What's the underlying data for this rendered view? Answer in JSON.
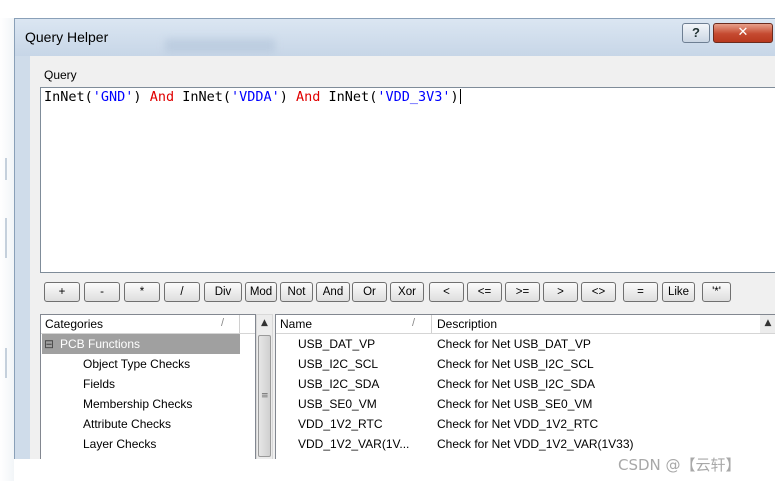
{
  "window": {
    "title": "Query Helper",
    "help_label": "?",
    "close_label": "✕"
  },
  "query": {
    "label": "Query",
    "tokens": [
      {
        "text": "InNet(",
        "kind": "fn"
      },
      {
        "text": "'GND'",
        "kind": "str"
      },
      {
        "text": ") ",
        "kind": "fn"
      },
      {
        "text": "And",
        "kind": "kw"
      },
      {
        "text": " InNet(",
        "kind": "fn"
      },
      {
        "text": "'VDDA'",
        "kind": "str"
      },
      {
        "text": ") ",
        "kind": "fn"
      },
      {
        "text": "And",
        "kind": "kw"
      },
      {
        "text": " InNet(",
        "kind": "fn"
      },
      {
        "text": "'VDD_3V3'",
        "kind": "str"
      },
      {
        "text": ")",
        "kind": "fn"
      }
    ]
  },
  "operators": [
    "+",
    "-",
    "*",
    "/",
    "Div",
    "Mod",
    "Not",
    "And",
    "Or",
    "Xor",
    "<",
    "<=",
    ">=",
    ">",
    "<>",
    "=",
    "Like",
    "'*'"
  ],
  "categories": {
    "header": "Categories",
    "sort_mark": "/",
    "root": {
      "expander": "⊟",
      "label": "PCB Functions"
    },
    "items": [
      "Object Type Checks",
      "Fields",
      "Membership Checks",
      "Attribute Checks",
      "Layer Checks"
    ]
  },
  "names": {
    "header_name": "Name",
    "header_desc": "Description",
    "sort_mark": "/",
    "rows": [
      {
        "name": "USB_DAT_VP",
        "desc": "Check for Net USB_DAT_VP"
      },
      {
        "name": "USB_I2C_SCL",
        "desc": "Check for Net USB_I2C_SCL"
      },
      {
        "name": "USB_I2C_SDA",
        "desc": "Check for Net USB_I2C_SDA"
      },
      {
        "name": "USB_SE0_VM",
        "desc": "Check for Net USB_SE0_VM"
      },
      {
        "name": "VDD_1V2_RTC",
        "desc": "Check for Net VDD_1V2_RTC"
      },
      {
        "name": "VDD_1V2_VAR(1V...",
        "desc": "Check for Net VDD_1V2_VAR(1V33)"
      }
    ]
  },
  "watermark": "CSDN @【云轩】",
  "colors": {
    "keyword": "#e00000",
    "string": "#0000ff",
    "selection": "#a0a0a0"
  }
}
